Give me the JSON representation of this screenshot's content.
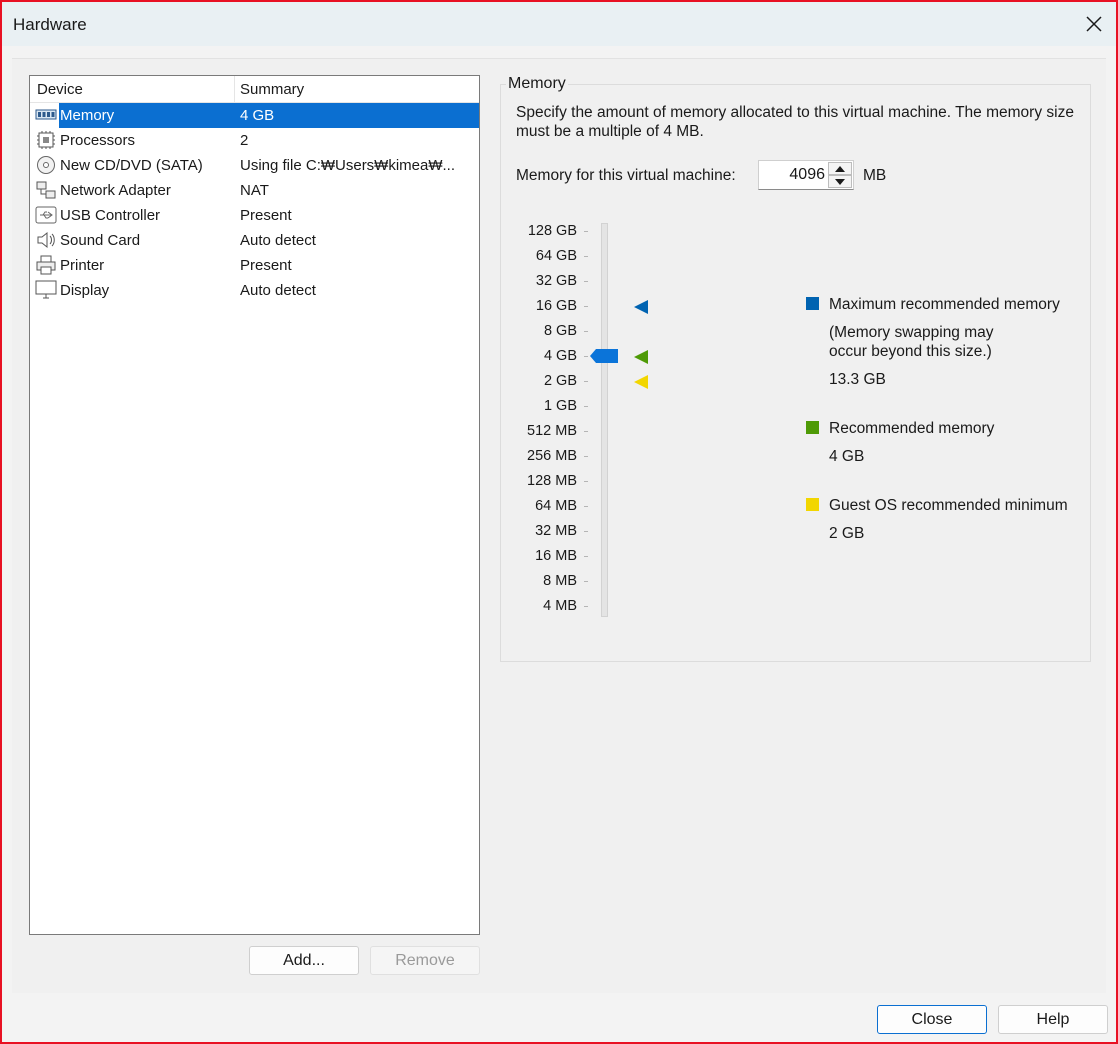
{
  "window": {
    "title": "Hardware"
  },
  "device_list": {
    "headers": {
      "device": "Device",
      "summary": "Summary"
    },
    "items": [
      {
        "name": "Memory",
        "summary": "4 GB",
        "icon": "memory-icon",
        "selected": true
      },
      {
        "name": "Processors",
        "summary": "2",
        "icon": "processor-icon"
      },
      {
        "name": "New CD/DVD (SATA)",
        "summary": "Using file C:₩Users₩kimea₩...",
        "icon": "cd-dvd-icon"
      },
      {
        "name": "Network Adapter",
        "summary": "NAT",
        "icon": "network-adapter-icon"
      },
      {
        "name": "USB Controller",
        "summary": "Present",
        "icon": "usb-icon"
      },
      {
        "name": "Sound Card",
        "summary": "Auto detect",
        "icon": "speaker-icon"
      },
      {
        "name": "Printer",
        "summary": "Present",
        "icon": "printer-icon"
      },
      {
        "name": "Display",
        "summary": "Auto detect",
        "icon": "display-icon"
      }
    ],
    "add_label": "Add...",
    "remove_label": "Remove"
  },
  "memory": {
    "group_title": "Memory",
    "description": "Specify the amount of memory allocated to this virtual machine. The memory size must be a multiple of 4 MB.",
    "field_label": "Memory for this virtual machine:",
    "value": "4096",
    "unit": "MB",
    "scale": [
      "128 GB",
      "64 GB",
      "32 GB",
      "16 GB",
      "8 GB",
      "4 GB",
      "2 GB",
      "1 GB",
      "512 MB",
      "256 MB",
      "128 MB",
      "64 MB",
      "32 MB",
      "16 MB",
      "8 MB",
      "4 MB"
    ],
    "slider_value": "4 GB",
    "max_recommended": {
      "label": "Maximum recommended memory",
      "note": "(Memory swapping may occur beyond this size.)",
      "value": "13.3 GB",
      "marker": "16 GB",
      "color": "#0063b1"
    },
    "recommended": {
      "label": "Recommended memory",
      "value": "4 GB",
      "marker": "4 GB",
      "color": "#4e9a06"
    },
    "guest_min": {
      "label": "Guest OS recommended minimum",
      "value": "2 GB",
      "marker": "2 GB",
      "color": "#f2d600"
    },
    "thumb_color": "#0b74d9"
  },
  "footer": {
    "close_label": "Close",
    "help_label": "Help"
  }
}
